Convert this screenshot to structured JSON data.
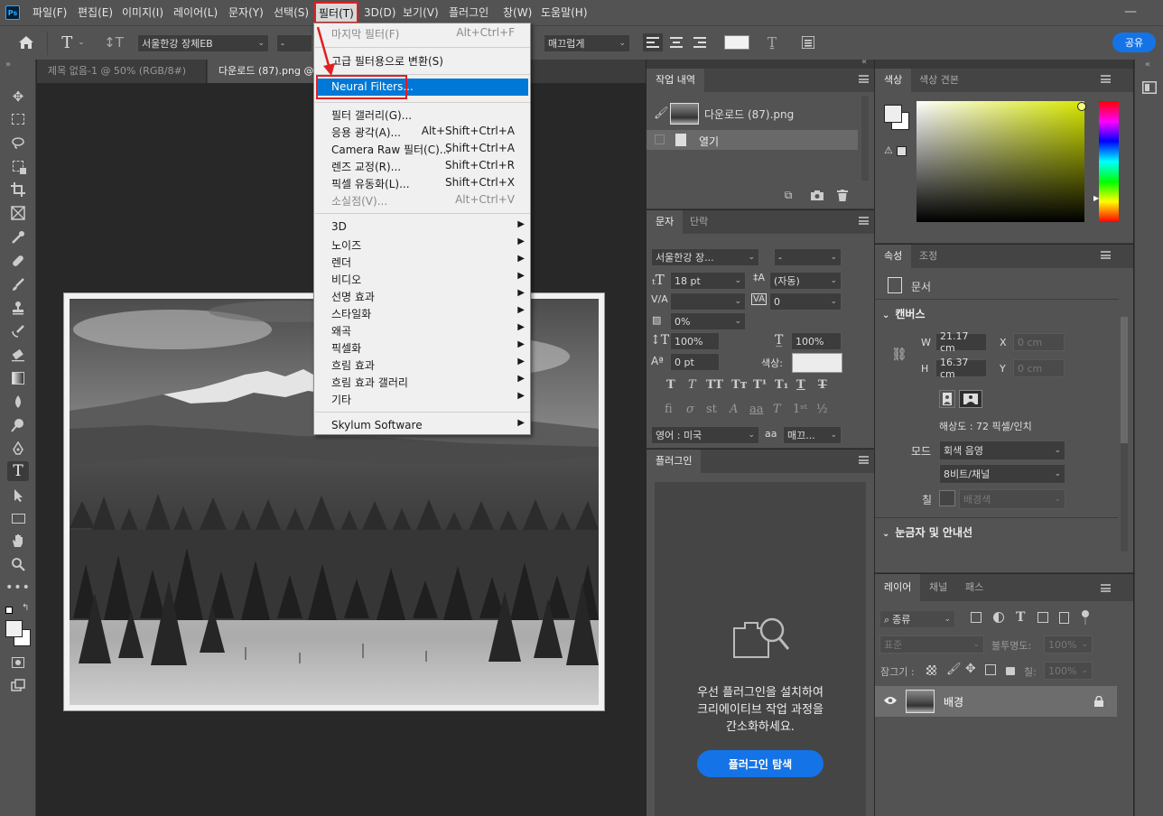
{
  "app": {
    "logo": "Ps"
  },
  "menubar": {
    "items": [
      "파일(F)",
      "편집(E)",
      "이미지(I)",
      "레이어(L)",
      "문자(Y)",
      "선택(S)",
      "필터(T)",
      "3D(D)",
      "보기(V)",
      "플러그인",
      "창(W)",
      "도움말(H)"
    ]
  },
  "options": {
    "font_family": "서울한강 장체EB",
    "font_style": "-",
    "antialias": "매끄럽게",
    "share_label": "공유"
  },
  "doc_tabs": [
    {
      "label": "제목 없음-1 @ 50% (RGB/8#)"
    },
    {
      "label": "다운로드 (87).png @"
    }
  ],
  "filter_menu": {
    "items": [
      {
        "label": "마지막 필터(F)",
        "shortcut": "Alt+Ctrl+F",
        "disabled": true
      },
      {
        "label": "고급 필터용으로 변환(S)",
        "shortcut": ""
      },
      {
        "label": "Neural Filters...",
        "shortcut": "",
        "highlighted": true
      },
      {
        "label": "필터 갤러리(G)...",
        "shortcut": ""
      },
      {
        "label": "응용 광각(A)...",
        "shortcut": "Alt+Shift+Ctrl+A"
      },
      {
        "label": "Camera Raw 필터(C)...",
        "shortcut": "Shift+Ctrl+A"
      },
      {
        "label": "렌즈 교정(R)...",
        "shortcut": "Shift+Ctrl+R"
      },
      {
        "label": "픽셀 유동화(L)...",
        "shortcut": "Shift+Ctrl+X"
      },
      {
        "label": "소실점(V)...",
        "shortcut": "Alt+Ctrl+V",
        "disabled": true
      },
      {
        "label": "3D",
        "submenu": true
      },
      {
        "label": "노이즈",
        "submenu": true
      },
      {
        "label": "렌더",
        "submenu": true
      },
      {
        "label": "비디오",
        "submenu": true
      },
      {
        "label": "선명 효과",
        "submenu": true
      },
      {
        "label": "스타일화",
        "submenu": true
      },
      {
        "label": "왜곡",
        "submenu": true
      },
      {
        "label": "픽셀화",
        "submenu": true
      },
      {
        "label": "흐림 효과",
        "submenu": true
      },
      {
        "label": "흐림 효과 갤러리",
        "submenu": true
      },
      {
        "label": "기타",
        "submenu": true
      },
      {
        "label": "Skylum Software",
        "submenu": true
      }
    ]
  },
  "history_panel": {
    "tabs": [
      "작업 내역"
    ],
    "snapshot": "다운로드 (87).png",
    "step": "열기"
  },
  "character_panel": {
    "tabs": [
      "문자",
      "단락"
    ],
    "font_family": "서울한강 장...",
    "font_style": "-",
    "size": "18 pt",
    "leading": "(자동)",
    "kerning": "",
    "tracking": "0",
    "tsume": "0%",
    "vscale": "100%",
    "hscale": "100%",
    "baseline": "0 pt",
    "color_label": "색상:",
    "language": "영어 : 미국",
    "aa_label": "aa",
    "aa_value": "매끄..."
  },
  "plugins_panel": {
    "tab": "플러그인",
    "message": [
      "우선 플러그인을 설치하여",
      "크리에이티브 작업 과정을",
      "간소화하세요."
    ],
    "button": "플러그인 탐색"
  },
  "color_panel": {
    "tabs": [
      "색상",
      "색상 견본"
    ],
    "hue_color": "#d8e800"
  },
  "properties_panel": {
    "tabs": [
      "속성",
      "조정"
    ],
    "doc_label": "문서",
    "canvas_header": "캔버스",
    "w_label": "W",
    "w_value": "21.17 cm",
    "x_label": "X",
    "x_value": "0 cm",
    "h_label": "H",
    "h_value": "16.37 cm",
    "y_label": "Y",
    "y_value": "0 cm",
    "resolution": "해상도 : 72 픽셀/인치",
    "mode_label": "모드",
    "mode_value": "회색 음영",
    "bits_value": "8비트/채널",
    "fill_label": "칠",
    "fill_value": "배경색",
    "rulers_header": "눈금자 및 안내선"
  },
  "layers_panel": {
    "tabs": [
      "레이어",
      "채널",
      "패스"
    ],
    "filter_kind": "종류",
    "blend_mode": "표준",
    "opacity_label": "불투명도:",
    "opacity_value": "100%",
    "lock_label": "잠그기 :",
    "fill_label": "칠:",
    "fill_value": "100%",
    "layer_name": "배경"
  },
  "colors": {
    "accent": "#1473e6",
    "highlight": "#0078d7",
    "annotation": "#e02020"
  }
}
